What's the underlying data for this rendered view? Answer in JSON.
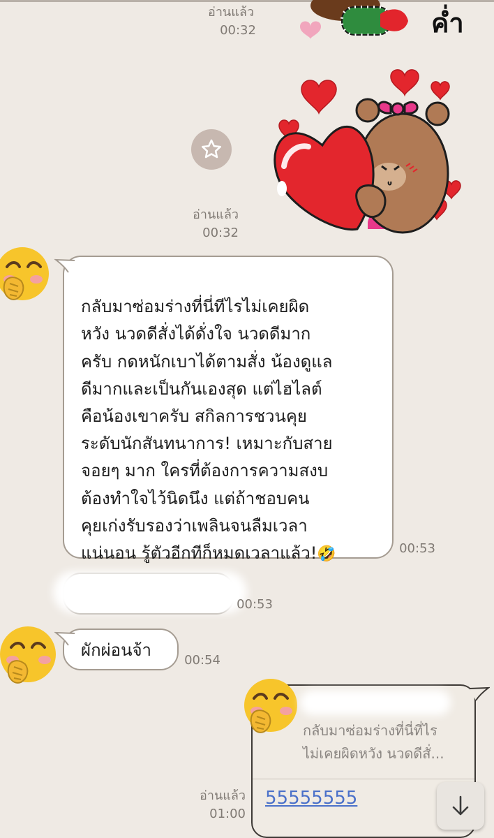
{
  "messages": {
    "sticker1": {
      "read": "อ่านแล้ว",
      "time": "00:32",
      "caption": "ค่ำ"
    },
    "sticker2": {
      "read": "อ่านแล้ว",
      "time": "00:32"
    },
    "review": {
      "text": "กลับมาซ่อมร่างที่นี่ทีไรไม่เคยผิด\nหวัง นวดดีสั่งได้ดั่งใจ นวดดีมาก\nครับ กดหนักเบาได้ตามสั่ง น้องดูแล\nดีมากและเป็นกันเองสุด แต่ไฮไลต์\nคือน้องเขาครับ สกิลการชวนคุย\nระดับนักสันทนาการ! เหมาะกับสาย\nจอยๆ มาก ใครที่ต้องการความสงบ\nต้องทำใจไว้นิดนึง แต่ถ้าชอบคน\nคุยเก่งรับรองว่าเพลินจนลืมเวลา\nแน่นอน รู้ตัวอีกทีก็หมดเวลาแล้ว!",
      "emoji": "🤣",
      "time": "00:53"
    },
    "hidden": {
      "time": "00:53"
    },
    "reply": {
      "text": "ผักผ่อนจ้า",
      "time": "00:54"
    },
    "last": {
      "read": "อ่านแล้ว",
      "time": "01:00",
      "quote": "กลับมาซ่อมร่างที่นี่ที่ไร\nไม่เคยผิดหวัง นวดดีสั่...",
      "link": "55555555"
    }
  },
  "colors": {
    "background": "#efeae4",
    "bubble_border": "#a59c92",
    "link": "#4a70c9"
  },
  "icons": [
    "star-icon",
    "scroll-down-arrow-icon",
    "avatar-face-icon"
  ]
}
